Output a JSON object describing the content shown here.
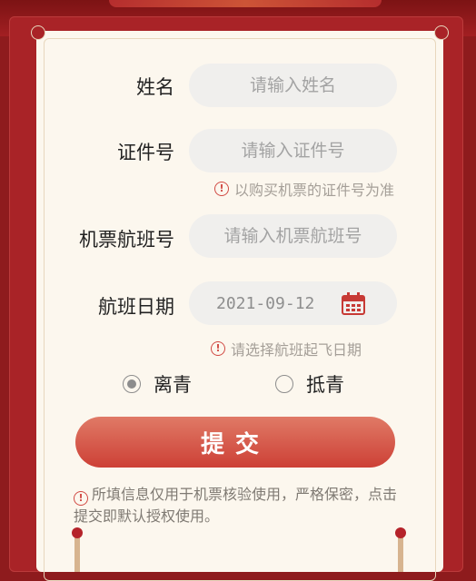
{
  "form": {
    "name_label": "姓名",
    "name_placeholder": "请输入姓名",
    "id_label": "证件号",
    "id_placeholder": "请输入证件号",
    "id_hint": "以购买机票的证件号为准",
    "flight_label": "机票航班号",
    "flight_placeholder": "请输入机票航班号",
    "date_label": "航班日期",
    "date_value": "2021-09-12",
    "date_hint": "请选择航班起飞日期",
    "radio_leave": "离青",
    "radio_arrive": "抵青",
    "radio_selected": "离青",
    "submit_label": "提交",
    "privacy_note": "所填信息仅用于机票核验使用，严格保密，点击提交即默认授权使用。"
  },
  "icons": {
    "warning": "warning-icon",
    "calendar": "calendar-icon"
  },
  "colors": {
    "background": "#8e1b1d",
    "card": "#fcf7ee",
    "accent": "#cd4036"
  }
}
